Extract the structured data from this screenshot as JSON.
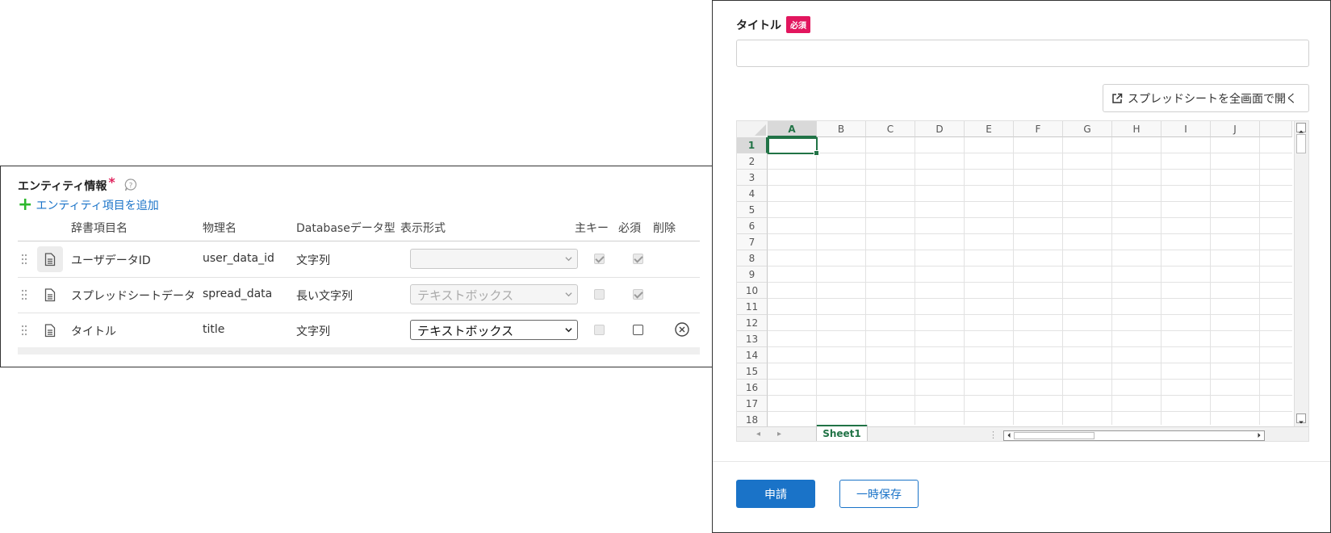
{
  "entity": {
    "title": "エンティティ情報",
    "required_mark": "*",
    "add_link": "エンティティ項目を追加",
    "columns": {
      "dict_name": "辞書項目名",
      "physical_name": "物理名",
      "db_type": "Databaseデータ型",
      "display_format": "表示形式",
      "primary_key": "主キー",
      "required": "必須",
      "delete": "削除"
    },
    "rows": [
      {
        "dict_name": "ユーザデータID",
        "physical_name": "user_data_id",
        "db_type": "文字列",
        "display_format": "",
        "primary_key": true,
        "required": true,
        "deletable": false
      },
      {
        "dict_name": "スプレッドシートデータ",
        "physical_name": "spread_data",
        "db_type": "長い文字列",
        "display_format": "テキストボックス",
        "primary_key": false,
        "required": true,
        "deletable": false
      },
      {
        "dict_name": "タイトル",
        "physical_name": "title",
        "db_type": "文字列",
        "display_format": "テキストボックス",
        "primary_key": false,
        "required": false,
        "deletable": true
      }
    ]
  },
  "form": {
    "title_label": "タイトル",
    "required_badge": "必須",
    "title_value": "",
    "open_fullscreen": "スプレッドシートを全画面で開く",
    "spreadsheet": {
      "columns": [
        "A",
        "B",
        "C",
        "D",
        "E",
        "F",
        "G",
        "H",
        "I",
        "J"
      ],
      "rows": [
        "1",
        "2",
        "3",
        "4",
        "5",
        "6",
        "7",
        "8",
        "9",
        "10",
        "11",
        "12",
        "13",
        "14",
        "15",
        "16",
        "17",
        "18"
      ],
      "active_cell": "A1",
      "sheet_tab": "Sheet1"
    },
    "submit_button": "申請",
    "draft_button": "一時保存"
  },
  "colors": {
    "accent": "#1a73c8",
    "badge": "#e2165e",
    "excel_green": "#217346",
    "add_plus": "#2db82d"
  }
}
